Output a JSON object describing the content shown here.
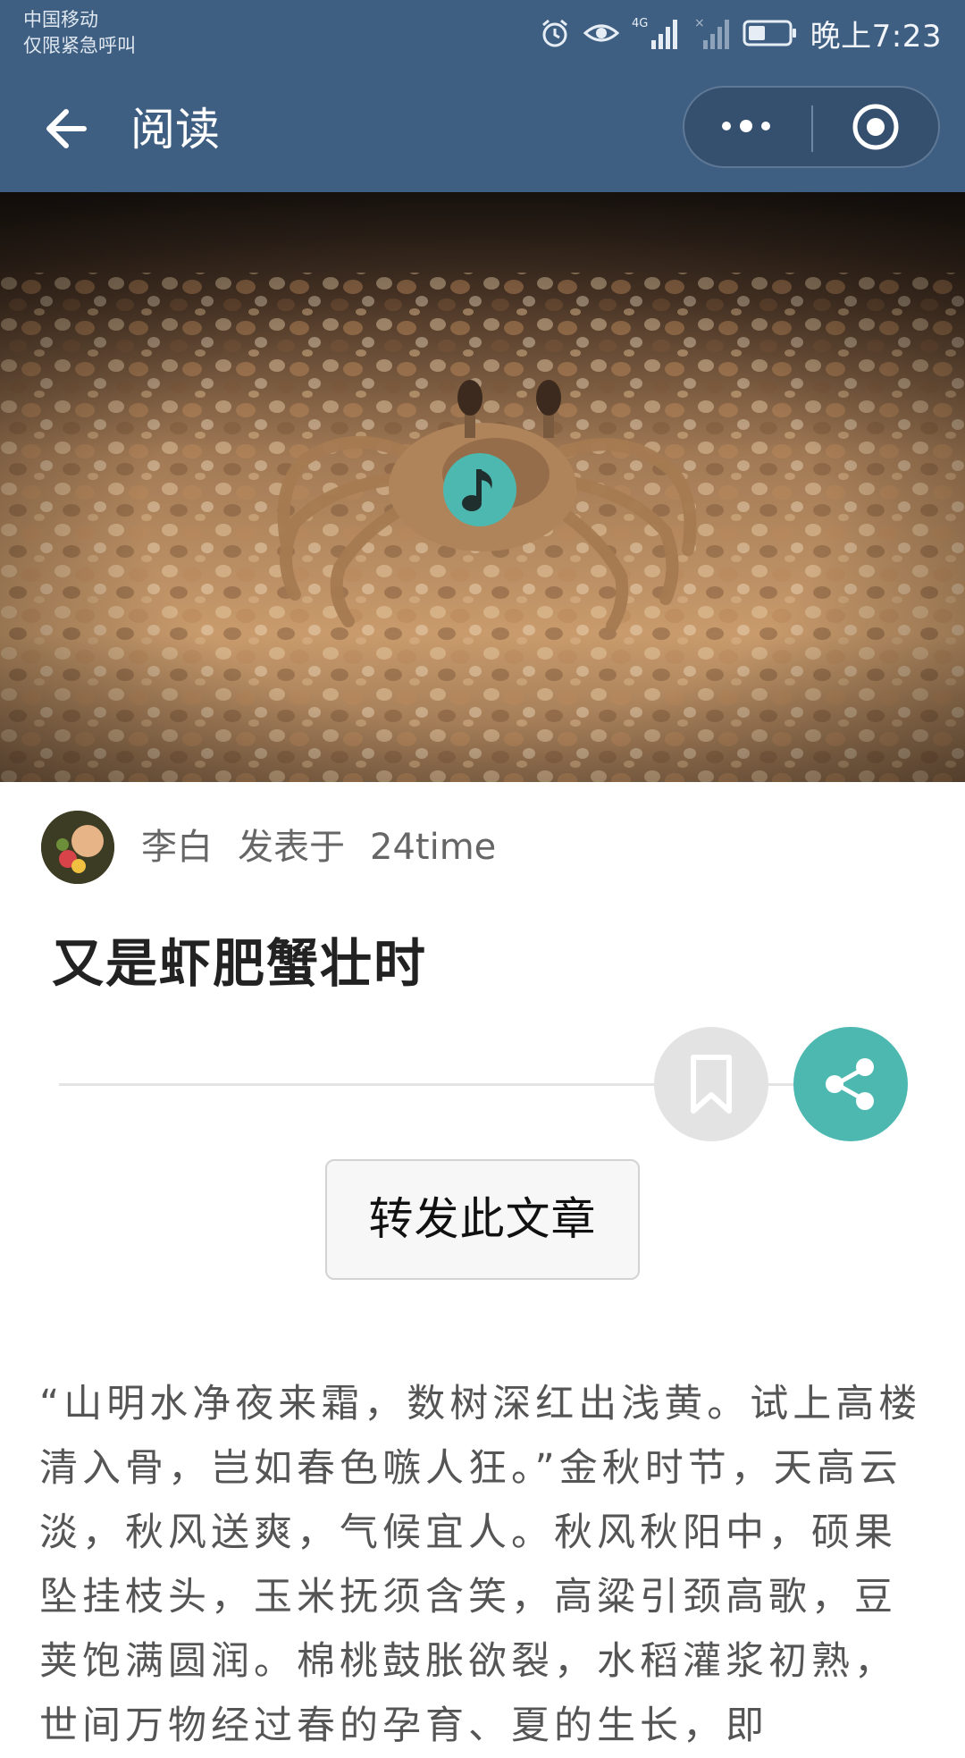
{
  "status_bar": {
    "carrier_line1": "中国移动",
    "carrier_line2": "仅限紧急呼叫",
    "network": "4G",
    "time": "晚上7:23"
  },
  "navbar": {
    "title": "阅读",
    "back_icon": "arrow-left-icon",
    "more_icon": "more-dots-icon",
    "close_icon": "target-circle-icon"
  },
  "hero": {
    "icon": "music-note-icon"
  },
  "article": {
    "author": "李白",
    "published_label": "发表于",
    "source": "24time",
    "title": "又是虾肥蟹壮时",
    "forward_button": "转发此文章",
    "body": "“山明水净夜来霜，数树深红出浅黄。试上高楼清入骨，岂如春色嗾人狂。”金秋时节，天高云淡，秋风送爽，气候宜人。秋风秋阳中，硕果坠挂枝头，玉米抚须含笑，高粱引颈高歌，豆荚饱满圆润。棉桃鼓胀欲裂，水稻灌浆初熟，世间万物经过春的孕育、夏的生长，即"
  },
  "actions": {
    "bookmark_icon": "bookmark-icon",
    "share_icon": "share-icon"
  },
  "colors": {
    "header": "#3f5f82",
    "accent_teal": "#4db8b0",
    "bookmark_gray": "#e3e3e3"
  }
}
